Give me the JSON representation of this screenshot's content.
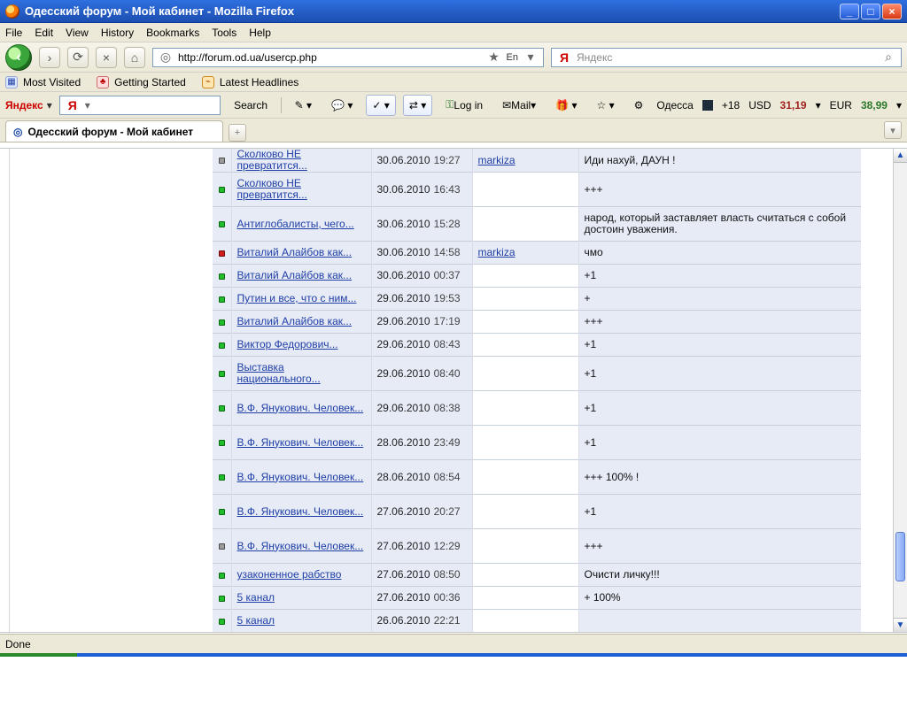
{
  "window": {
    "title": "Одесский форум - Мой кабинет - Mozilla Firefox",
    "controls": [
      "_",
      "□",
      "×"
    ]
  },
  "menubar": {
    "items": [
      "File",
      "Edit",
      "View",
      "History",
      "Bookmarks",
      "Tools",
      "Help"
    ]
  },
  "navbar": {
    "url": "http://forum.od.ua/usercp.php",
    "url_badge": "En",
    "search_placeholder": "Яндекс"
  },
  "bookmarks": {
    "items": [
      "Most Visited",
      "Getting Started",
      "Latest Headlines"
    ]
  },
  "yandex_toolbar": {
    "brand": "Яндекс",
    "input_prefix": "Я",
    "search_button": "Search",
    "login": "Log in",
    "mail": "Mail",
    "weather_city": "Одесса",
    "weather_temp": "+18",
    "usd_label": "USD",
    "usd_value": "31,19",
    "eur_label": "EUR",
    "eur_value": "38,99"
  },
  "tab": {
    "title": "Одесский форум - Мой кабинет",
    "new_tab_symbol": "+",
    "dropdown_symbol": "▾"
  },
  "table": {
    "rows": [
      {
        "status": "gray",
        "topic": "Сколково НЕ превратится...",
        "date": "30.06.2010",
        "time": "19:27",
        "user": "markiza",
        "user_bg": "filled",
        "message": "Иди нахуй, ДАУН !",
        "height": "h26"
      },
      {
        "status": "green",
        "topic": "Сколково НЕ превратится...",
        "date": "30.06.2010",
        "time": "16:43",
        "user": "",
        "user_bg": "",
        "message": "+++",
        "height": "h39"
      },
      {
        "status": "green",
        "topic": "Антиглобалисты, чего...",
        "date": "30.06.2010",
        "time": "15:28",
        "user": "",
        "user_bg": "",
        "message": "народ, который заставляет власть считаться с собой достоин уважения.",
        "height": "h39"
      },
      {
        "status": "red",
        "topic": "Виталий Алайбов как...",
        "date": "30.06.2010",
        "time": "14:58",
        "user": "markiza",
        "user_bg": "filled",
        "message": "чмо",
        "height": "h26"
      },
      {
        "status": "green",
        "topic": "Виталий Алайбов как...",
        "date": "30.06.2010",
        "time": "00:37",
        "user": "",
        "user_bg": "",
        "message": "+1",
        "height": "h26"
      },
      {
        "status": "green",
        "topic": "Путин и все, что с ним...",
        "date": "29.06.2010",
        "time": "19:53",
        "user": "",
        "user_bg": "",
        "message": "+",
        "height": "h26"
      },
      {
        "status": "green",
        "topic": "Виталий Алайбов как...",
        "date": "29.06.2010",
        "time": "17:19",
        "user": "",
        "user_bg": "",
        "message": "+++",
        "height": "h26"
      },
      {
        "status": "green",
        "topic": "Виктор Федорович...",
        "date": "29.06.2010",
        "time": "08:43",
        "user": "",
        "user_bg": "",
        "message": "+1",
        "height": "h26"
      },
      {
        "status": "green",
        "topic": "Выставка национального...",
        "date": "29.06.2010",
        "time": "08:40",
        "user": "",
        "user_bg": "",
        "message": "+1",
        "height": "h39"
      },
      {
        "status": "green",
        "topic": "В.Ф. Янукович. Человек...",
        "date": "29.06.2010",
        "time": "08:38",
        "user": "",
        "user_bg": "",
        "message": "+1",
        "height": "h39"
      },
      {
        "status": "green",
        "topic": "В.Ф. Янукович. Человек...",
        "date": "28.06.2010",
        "time": "23:49",
        "user": "",
        "user_bg": "",
        "message": "+1",
        "height": "h39"
      },
      {
        "status": "green",
        "topic": "В.Ф. Янукович. Человек...",
        "date": "28.06.2010",
        "time": "08:54",
        "user": "",
        "user_bg": "",
        "message": "+++ 100% !",
        "height": "h39"
      },
      {
        "status": "green",
        "topic": "В.Ф. Янукович. Человек...",
        "date": "27.06.2010",
        "time": "20:27",
        "user": "",
        "user_bg": "",
        "message": "+1",
        "height": "h39"
      },
      {
        "status": "gray",
        "topic": "В.Ф. Янукович. Человек...",
        "date": "27.06.2010",
        "time": "12:29",
        "user": "",
        "user_bg": "",
        "message": "+++",
        "height": "h39"
      },
      {
        "status": "green",
        "topic": "узаконенное рабство",
        "date": "27.06.2010",
        "time": "08:50",
        "user": "",
        "user_bg": "",
        "message": "Очисти личку!!!",
        "height": "h26"
      },
      {
        "status": "green",
        "topic": "5 канал",
        "date": "27.06.2010",
        "time": "00:36",
        "user": "",
        "user_bg": "",
        "message": "+ 100%",
        "height": "h26"
      },
      {
        "status": "green",
        "topic": "5 канал",
        "date": "26.06.2010",
        "time": "22:21",
        "user": "",
        "user_bg": "",
        "message": "",
        "height": "h26"
      }
    ]
  },
  "statusbar": {
    "text": "Done"
  }
}
